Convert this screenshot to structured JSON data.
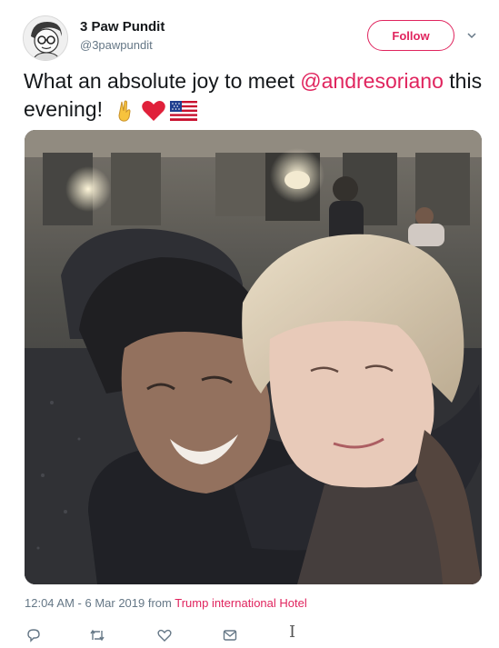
{
  "author": {
    "display_name": "3 Paw Pundit",
    "handle": "@3pawpundit",
    "avatar": "cartoon-avatar-with-glasses"
  },
  "follow_button": {
    "label": "Follow"
  },
  "tweet": {
    "text_before": "What an absolute joy to meet ",
    "mention": "@andresoriano",
    "text_after": " this evening!",
    "emojis": [
      "victory-hand",
      "red-heart",
      "us-flag"
    ]
  },
  "photo": {
    "subject": "selfie-two-people-in-hotel-lobby"
  },
  "meta": {
    "timestamp": "12:04 AM - 6 Mar 2019",
    "from_label": " from ",
    "venue": "Trump international Hotel"
  },
  "actions": [
    "reply-icon",
    "retweet-icon",
    "like-icon",
    "direct-message-icon"
  ],
  "colors": {
    "accent": "#e0245e",
    "muted_text": "#657786",
    "text": "#14171a"
  }
}
